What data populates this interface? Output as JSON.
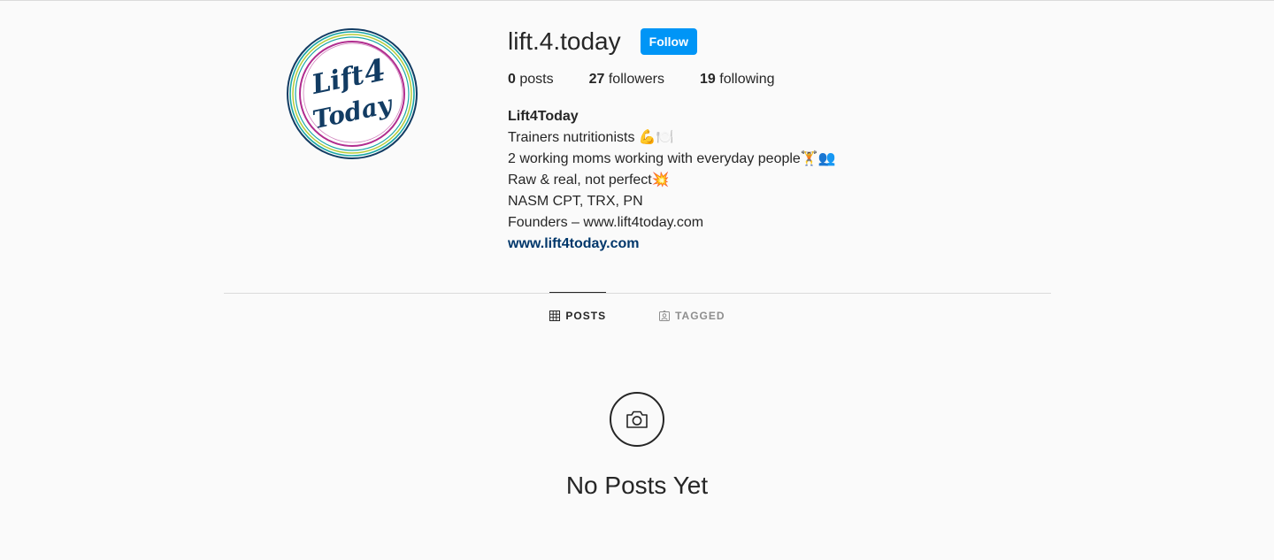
{
  "profile": {
    "username": "lift.4.today",
    "follow_label": "Follow",
    "avatar_logo_text_line1": "Lift",
    "avatar_logo_text_number": "4",
    "avatar_logo_text_line2": "Today"
  },
  "stats": {
    "posts_count": "0",
    "posts_label": "posts",
    "followers_count": "27",
    "followers_label": "followers",
    "following_count": "19",
    "following_label": "following"
  },
  "bio": {
    "name": "Lift4Today",
    "lines": [
      "Trainers nutritionists 💪🍽️",
      "2 working moms working with everyday people🏋👥",
      "Raw & real, not perfect💥",
      "NASM CPT, TRX, PN",
      "Founders – www.lift4today.com"
    ],
    "link": "www.lift4today.com"
  },
  "tabs": [
    {
      "label": "POSTS",
      "icon": "grid-icon",
      "active": true
    },
    {
      "label": "TAGGED",
      "icon": "tagged-icon",
      "active": false
    }
  ],
  "empty_state": {
    "icon": "camera-icon",
    "title": "No Posts Yet"
  },
  "colors": {
    "accent": "#0095f6",
    "link": "#00376b",
    "logo_navy": "#123c63",
    "logo_teal": "#1aa6a6",
    "logo_magenta": "#b12d8f",
    "logo_lime": "#b7cc3a"
  }
}
